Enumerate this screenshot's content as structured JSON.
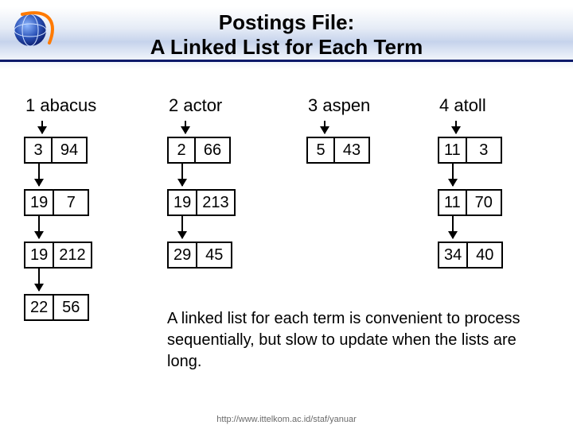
{
  "header": {
    "title_line1": "Postings File:",
    "title_line2": "A Linked List for Each Term"
  },
  "terms": [
    {
      "label": "1 abacus",
      "postings": [
        {
          "doc": "3",
          "tf": "94"
        },
        {
          "doc": "19",
          "tf": "7"
        },
        {
          "doc": "19",
          "tf": "212"
        },
        {
          "doc": "22",
          "tf": "56"
        }
      ]
    },
    {
      "label": "2 actor",
      "postings": [
        {
          "doc": "2",
          "tf": "66"
        },
        {
          "doc": "19",
          "tf": "213"
        },
        {
          "doc": "29",
          "tf": "45"
        }
      ]
    },
    {
      "label": "3 aspen",
      "postings": [
        {
          "doc": "5",
          "tf": "43"
        }
      ]
    },
    {
      "label": "4 atoll",
      "postings": [
        {
          "doc": "11",
          "tf": "3"
        },
        {
          "doc": "11",
          "tf": "70"
        },
        {
          "doc": "34",
          "tf": "40"
        }
      ]
    }
  ],
  "note": "A linked list for each term is convenient to process sequentially, but slow to update when the lists are long.",
  "footer": "http://www.ittelkom.ac.id/staf/yanuar"
}
